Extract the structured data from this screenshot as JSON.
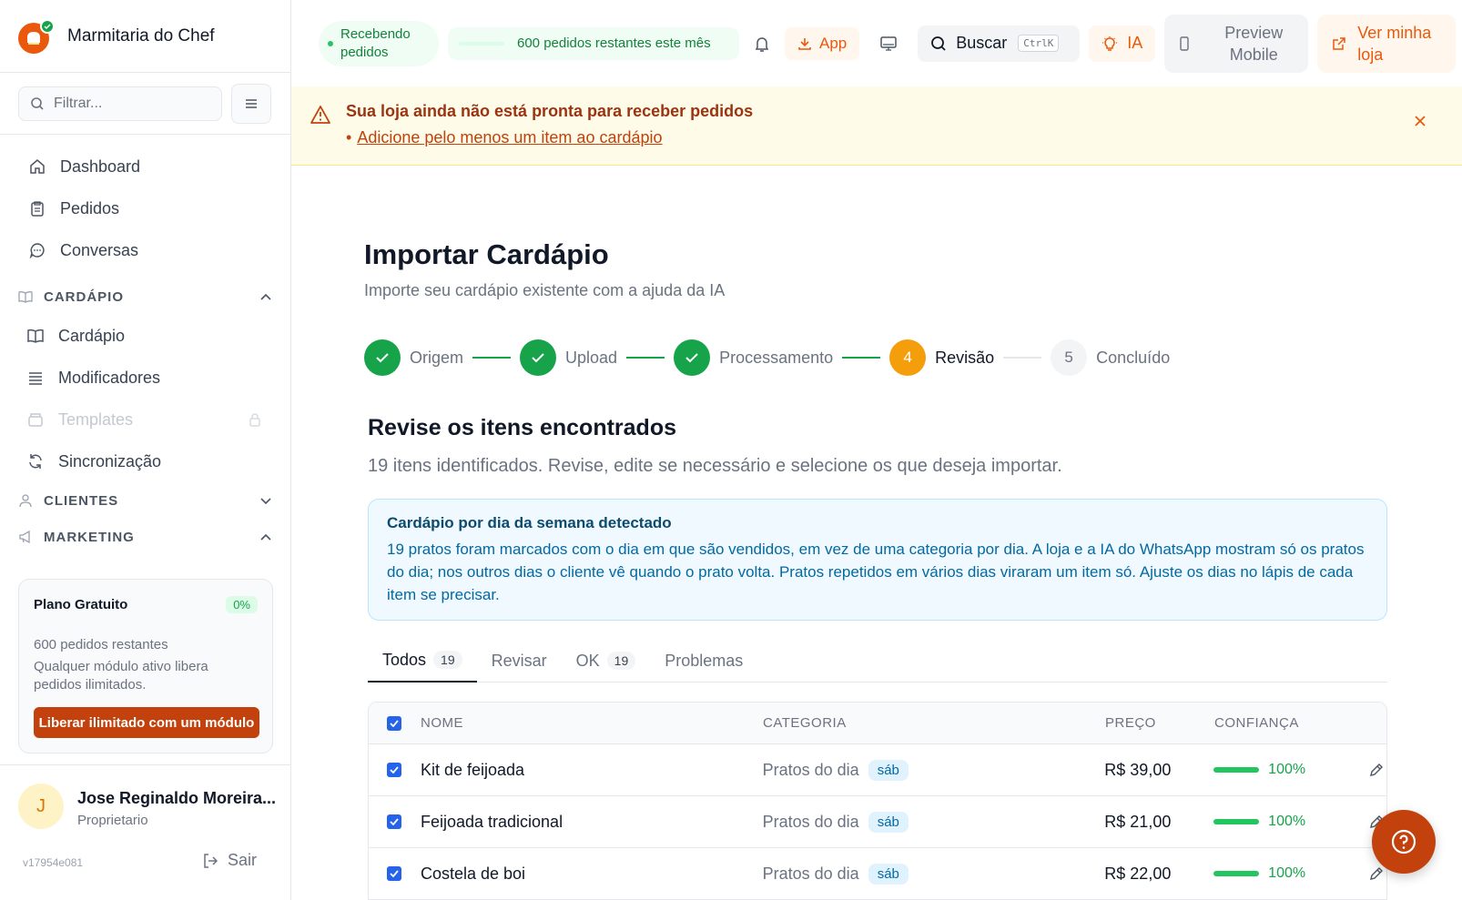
{
  "brand": {
    "name": "Marmitaria do Chef"
  },
  "filter": {
    "placeholder": "Filtrar..."
  },
  "nav": {
    "main": [
      {
        "label": "Dashboard",
        "icon": "home-icon"
      },
      {
        "label": "Pedidos",
        "icon": "clipboard-icon"
      },
      {
        "label": "Conversas",
        "icon": "chat-icon"
      }
    ],
    "cardapio_section": "CARDÁPIO",
    "cardapio_items": [
      {
        "label": "Cardápio",
        "icon": "book-icon"
      },
      {
        "label": "Modificadores",
        "icon": "list-icon"
      },
      {
        "label": "Templates",
        "icon": "template-icon",
        "locked": true
      },
      {
        "label": "Sincronização",
        "icon": "sync-icon"
      }
    ],
    "clientes_section": "CLIENTES",
    "marketing_section": "MARKETING"
  },
  "plan": {
    "title": "Plano Gratuito",
    "percent": "0%",
    "remaining": "600 pedidos restantes",
    "description": "Qualquer módulo ativo libera pedidos ilimitados.",
    "cta": "Liberar ilimitado com um módulo"
  },
  "user": {
    "initial": "J",
    "name": "Jose Reginaldo Moreira...",
    "role": "Proprietario",
    "version": "v17954e081",
    "logout": "Sair"
  },
  "topbar": {
    "status": "Recebendo pedidos",
    "orders_left": "600 pedidos restantes este mês",
    "orders_progress": 0,
    "app": "App",
    "search": "Buscar",
    "search_shortcut": "CtrlK",
    "ia": "IA",
    "preview": "Preview Mobile",
    "ver_loja": "Ver minha loja"
  },
  "alert": {
    "title": "Sua loja ainda não está pronta para receber pedidos",
    "bullet": "•",
    "link": "Adicione pelo menos um item ao cardápio"
  },
  "page": {
    "title": "Importar Cardápio",
    "subtitle": "Importe seu cardápio existente com a ajuda da IA"
  },
  "steps": [
    {
      "label": "Origem",
      "status": "done"
    },
    {
      "label": "Upload",
      "status": "done"
    },
    {
      "label": "Processamento",
      "status": "done"
    },
    {
      "number": "4",
      "label": "Revisão",
      "status": "current"
    },
    {
      "number": "5",
      "label": "Concluído",
      "status": "todo"
    }
  ],
  "review": {
    "title": "Revise os itens encontrados",
    "subtitle": "19 itens identificados. Revise, edite se necessário e selecione os que deseja importar."
  },
  "info": {
    "title": "Cardápio por dia da semana detectado",
    "text": "19 pratos foram marcados com o dia em que são vendidos, em vez de uma categoria por dia. A loja e a IA do WhatsApp mostram só os pratos do dia; nos outros dias o cliente vê quando o prato volta. Pratos repetidos em vários dias viraram um item só. Ajuste os dias no lápis de cada item se precisar."
  },
  "tabs": [
    {
      "label": "Todos",
      "count": "19",
      "active": true
    },
    {
      "label": "Revisar"
    },
    {
      "label": "OK",
      "count": "19"
    },
    {
      "label": "Problemas"
    }
  ],
  "table": {
    "headers": {
      "name": "NOME",
      "category": "CATEGORIA",
      "price": "PREÇO",
      "confidence": "CONFIANÇA"
    },
    "rows": [
      {
        "name": "Kit de feijoada",
        "category": "Pratos do dia",
        "day": "sáb",
        "price": "R$ 39,00",
        "confidence": "100%"
      },
      {
        "name": "Feijoada tradicional",
        "category": "Pratos do dia",
        "day": "sáb",
        "price": "R$ 21,00",
        "confidence": "100%"
      },
      {
        "name": "Costela de boi",
        "category": "Pratos do dia",
        "day": "sáb",
        "price": "R$ 22,00",
        "confidence": "100%"
      }
    ]
  },
  "colors": {
    "accent": "#ea580c",
    "success": "#16a34a",
    "step_current": "#f59e0b",
    "checkbox": "#2563eb"
  }
}
